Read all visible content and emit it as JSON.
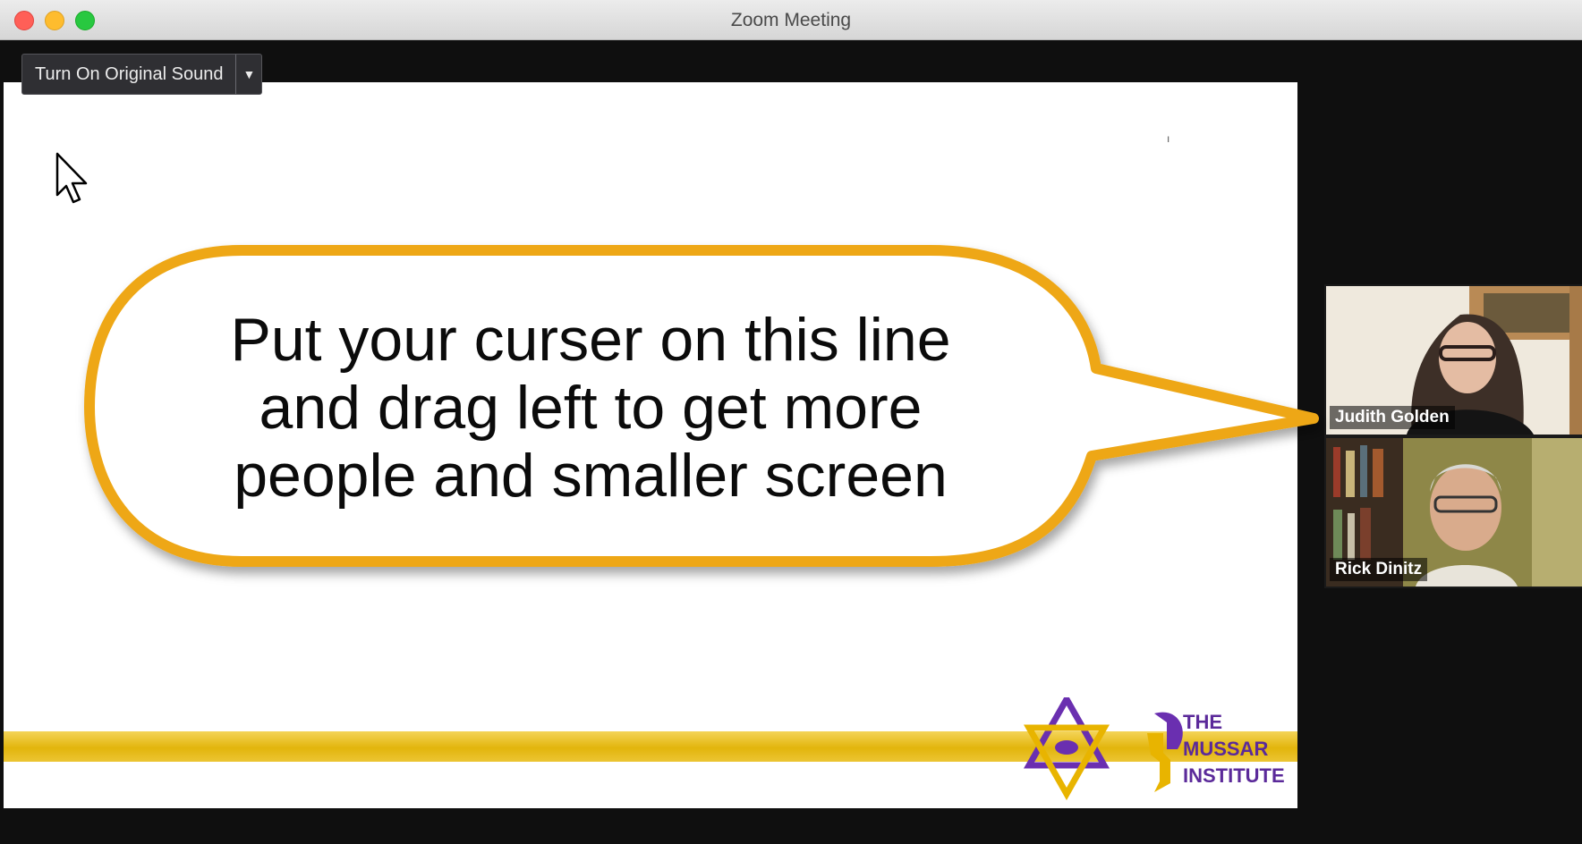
{
  "window": {
    "title": "Zoom Meeting"
  },
  "toolbar": {
    "original_sound_label": "Turn On Original Sound"
  },
  "slide": {
    "callout_lines": [
      "Put your curser on this line",
      "and drag left to get more",
      "people and smaller screen"
    ],
    "logo_lines": [
      "THE",
      "MUSSAR",
      "INSTITUTE"
    ],
    "accent_color": "#e8b400",
    "brand_color": "#5b2a9a"
  },
  "participants": [
    {
      "name": "Judith Golden"
    },
    {
      "name": "Rick Dinitz"
    }
  ],
  "icons": [
    "close-icon",
    "minimize-icon",
    "maximize-icon",
    "chevron-down-icon",
    "mouse-cursor-icon"
  ]
}
